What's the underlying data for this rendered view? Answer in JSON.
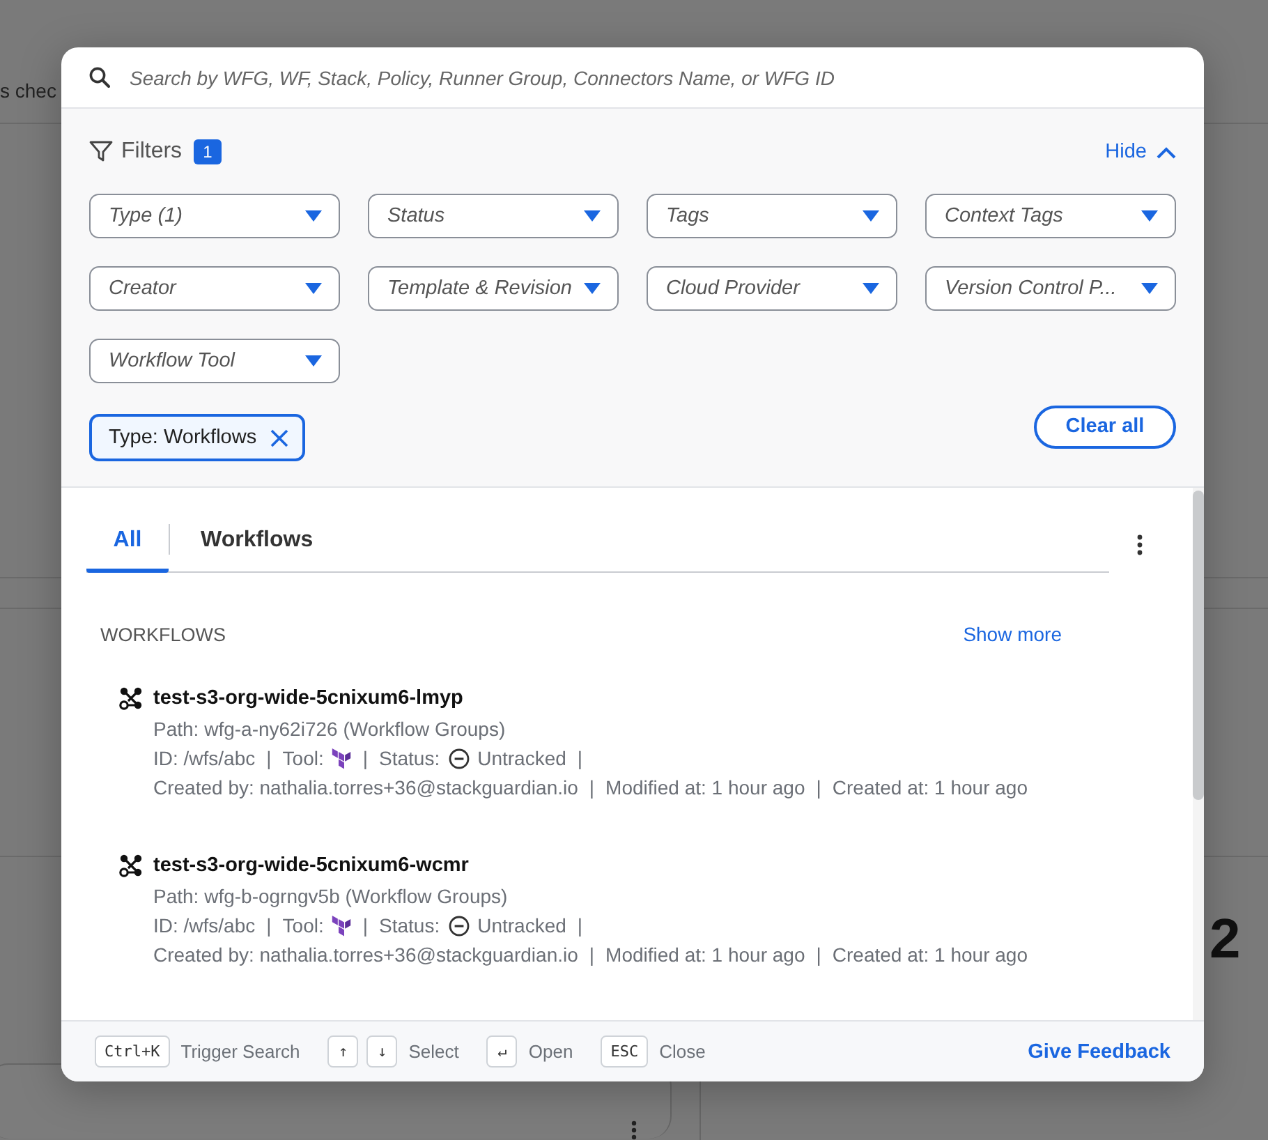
{
  "background": {
    "texts": [
      {
        "text": "s chec",
        "kind": "caption"
      },
      {
        "text": "2",
        "kind": "figure"
      }
    ]
  },
  "search": {
    "placeholder": "Search by WFG, WF, Stack, Policy, Runner Group, Connectors Name, or WFG ID"
  },
  "filters": {
    "label": "Filters",
    "count": "1",
    "toggle": "Hide",
    "expanded": true,
    "dropdowns": [
      {
        "label": "Type (1)"
      },
      {
        "label": "Status"
      },
      {
        "label": "Tags"
      },
      {
        "label": "Context Tags"
      },
      {
        "label": "Creator"
      },
      {
        "label": "Template & Revision"
      },
      {
        "label": "Cloud Provider"
      },
      {
        "label": "Version Control P..."
      },
      {
        "label": "Workflow Tool"
      }
    ],
    "chips": [
      {
        "label": "Type: Workflows"
      }
    ],
    "clear_all": "Clear all"
  },
  "tabs": [
    {
      "label": "All",
      "selected": true
    },
    {
      "label": "Workflows",
      "selected": false
    }
  ],
  "section": {
    "title": "WORKFLOWS",
    "show_more": "Show more",
    "separator": "|"
  },
  "results": [
    {
      "name": "test-s3-org-wide-5cnixum6-lmyp",
      "path": "Path: wfg-a-ny62i726 (Workflow Groups)",
      "id": "ID: /wfs/abc",
      "tool_label": "Tool:",
      "status_label": "Status:",
      "status": "Untracked",
      "created_by": "Created by: nathalia.torres+36@stackguardian.io",
      "modified": "Modified at: 1 hour ago",
      "created": "Created at: 1 hour ago"
    },
    {
      "name": "test-s3-org-wide-5cnixum6-wcmr",
      "path": "Path: wfg-b-ogrngv5b (Workflow Groups)",
      "id": "ID: /wfs/abc",
      "tool_label": "Tool:",
      "status_label": "Status:",
      "status": "Untracked",
      "created_by": "Created by: nathalia.torres+36@stackguardian.io",
      "modified": "Modified at: 1 hour ago",
      "created": "Created at: 1 hour ago"
    }
  ],
  "footer": {
    "shortcuts": [
      {
        "keys": [
          "Ctrl+K"
        ],
        "label": "Trigger Search"
      },
      {
        "keys": [
          "↑",
          "↓"
        ],
        "label": "Select"
      },
      {
        "keys": [
          "↵"
        ],
        "label": "Open"
      },
      {
        "keys": [
          "ESC"
        ],
        "label": "Close"
      }
    ],
    "feedback": "Give Feedback"
  }
}
